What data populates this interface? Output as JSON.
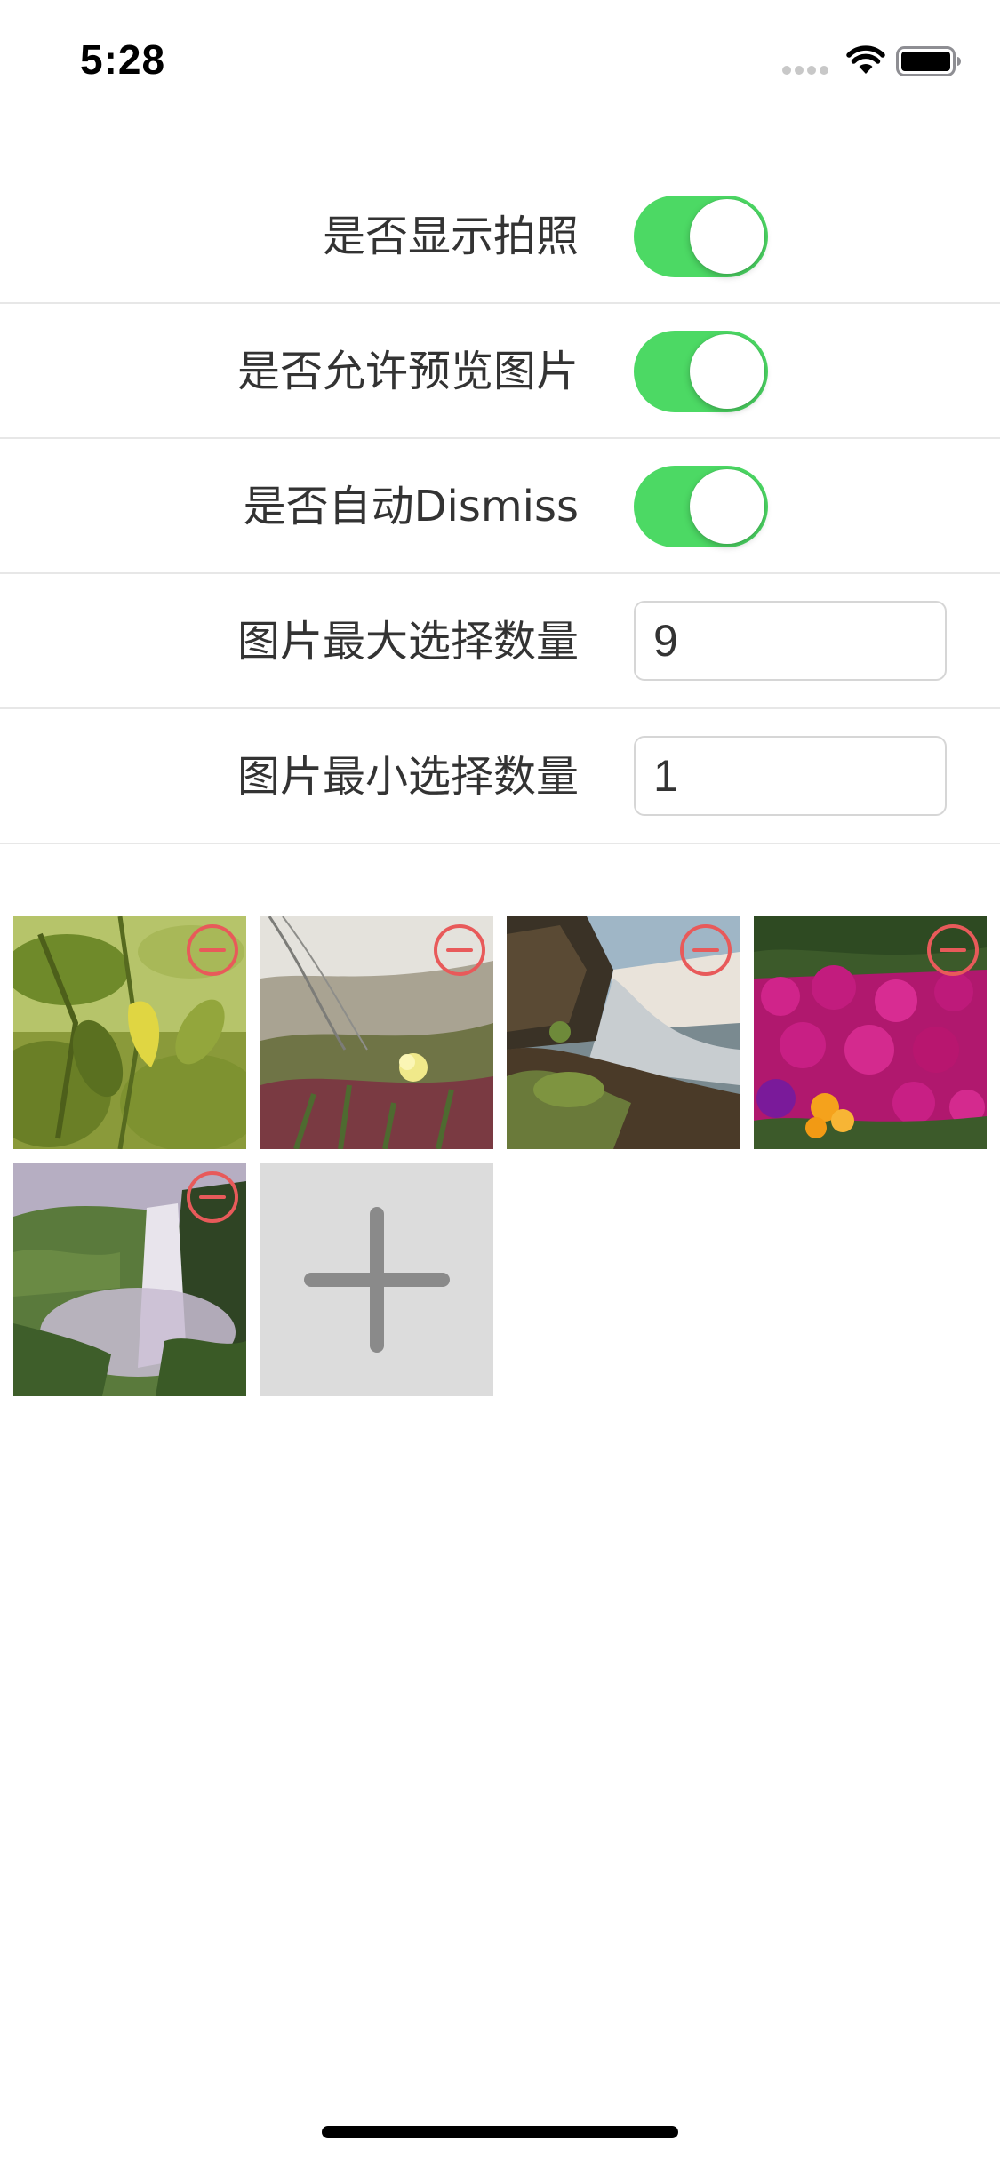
{
  "status_bar": {
    "time": "5:28",
    "icons": [
      "signal-dots-icon",
      "wifi-icon",
      "battery-icon"
    ]
  },
  "settings": {
    "show_camera": {
      "label": "是否显示拍照",
      "on": true
    },
    "allow_preview": {
      "label": "是否允许预览图片",
      "on": true
    },
    "auto_dismiss": {
      "label": "是否自动Dismiss",
      "on": true
    },
    "max_count": {
      "label": "图片最大选择数量",
      "value": "9"
    },
    "min_count": {
      "label": "图片最小选择数量",
      "value": "1"
    }
  },
  "photos": [
    {
      "subject": "green leaves"
    },
    {
      "subject": "yellow flower on dune"
    },
    {
      "subject": "waterfall over rocks"
    },
    {
      "subject": "magenta flower field"
    },
    {
      "subject": "tall waterfall in valley"
    }
  ],
  "icons": {
    "delete": "minus-circle-icon",
    "add": "plus-icon"
  },
  "colors": {
    "switch_on": "#4cd964",
    "delete_icon": "#e85a5a",
    "add_tile": "#dcdcdc",
    "add_plus": "#8a8a8a",
    "divider": "#e7e7e7"
  }
}
